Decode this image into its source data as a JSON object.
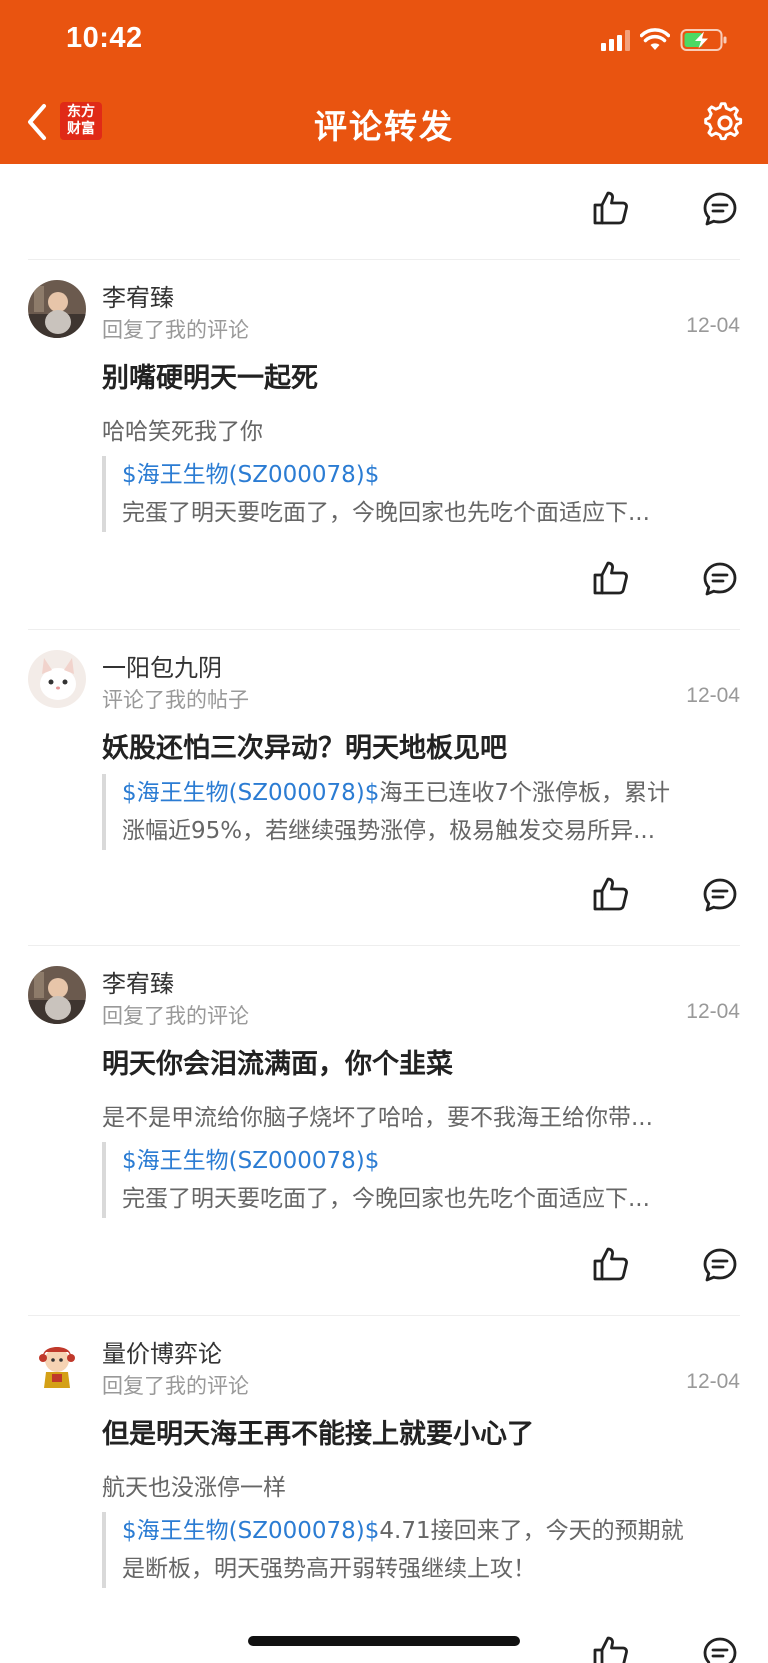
{
  "status_bar": {
    "time": "10:42"
  },
  "nav": {
    "title": "评论转发",
    "logo_top": "东方",
    "logo_bottom": "财富",
    "back_icon": "chevron-left-icon",
    "settings_icon": "gear-icon"
  },
  "colors": {
    "brand": "#E95410",
    "link": "#2B7CD3",
    "muted": "#999999"
  },
  "items": [
    {
      "user": "李宥臻",
      "action": "回复了我的评论",
      "date": "12-04",
      "headline": "别嘴硬明天一起死",
      "reply": "哈哈笑死我了你",
      "quote_tag": "$海王生物(SZ000078)$",
      "quote_line1": "",
      "quote_line2": "完蛋了明天要吃面了，今晚回家也先吃个面适应下..."
    },
    {
      "user": "一阳包九阴",
      "action": "评论了我的帖子",
      "date": "12-04",
      "headline": "妖股还怕三次异动？明天地板见吧",
      "quote_tag": "$海王生物(SZ000078)$",
      "quote_line1": "海王已连收7个涨停板，累计",
      "quote_line2": "涨幅近95%，若继续强势涨停，极易触发交易所异..."
    },
    {
      "user": "李宥臻",
      "action": "回复了我的评论",
      "date": "12-04",
      "headline": "明天你会泪流满面，你个韭菜",
      "reply": "是不是甲流给你脑子烧坏了哈哈，要不我海王给你带...",
      "quote_tag": "$海王生物(SZ000078)$",
      "quote_line1": "",
      "quote_line2": "完蛋了明天要吃面了，今晚回家也先吃个面适应下..."
    },
    {
      "user": "量价博弈论",
      "action": "回复了我的评论",
      "date": "12-04",
      "headline": "但是明天海王再不能接上就要小心了",
      "reply": "航天也没涨停一样",
      "quote_tag": "$海王生物(SZ000078)$",
      "quote_line1": "4.71接回来了，今天的预期就",
      "quote_line2": "是断板，明天强势高开弱转强继续上攻！"
    }
  ]
}
